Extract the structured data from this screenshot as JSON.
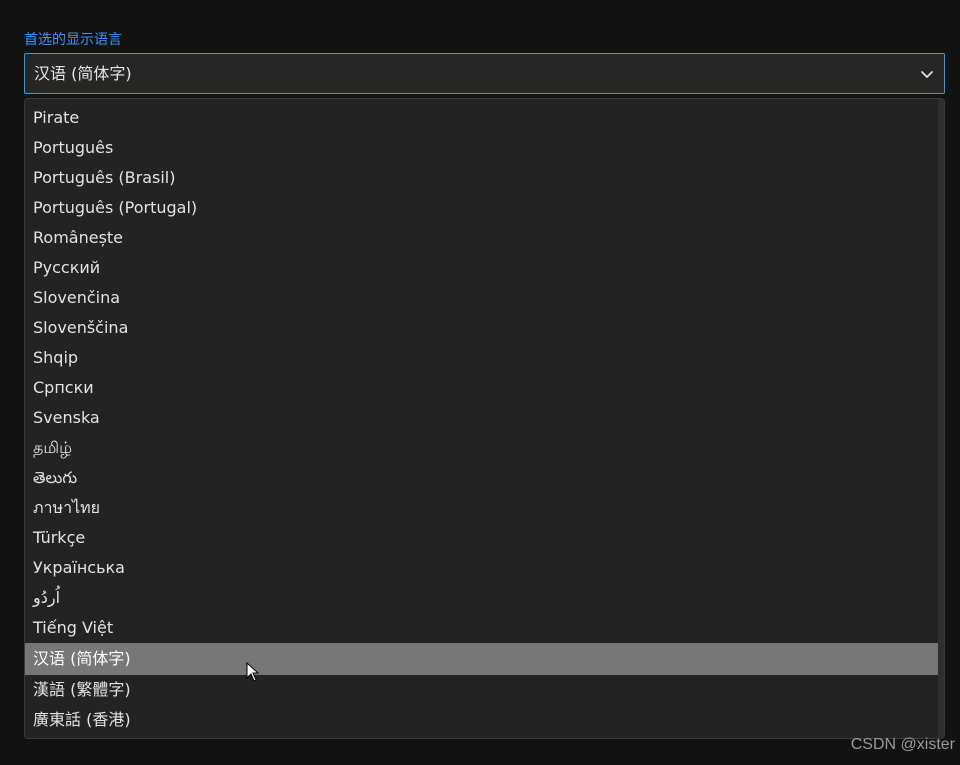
{
  "field": {
    "label": "首选的显示语言",
    "selected_value": "汉语 (简体字)",
    "chevron_icon": "chevron-down-icon"
  },
  "options": [
    {
      "label": "Pirate"
    },
    {
      "label": "Português"
    },
    {
      "label": "Português (Brasil)"
    },
    {
      "label": "Português (Portugal)"
    },
    {
      "label": "Românește"
    },
    {
      "label": "Русский"
    },
    {
      "label": "Slovenčina"
    },
    {
      "label": "Slovenščina"
    },
    {
      "label": "Shqip"
    },
    {
      "label": "Српски"
    },
    {
      "label": "Svenska"
    },
    {
      "label": "தமிழ்"
    },
    {
      "label": "తెలుగు"
    },
    {
      "label": "ภาษาไทย"
    },
    {
      "label": "Türkçe"
    },
    {
      "label": "Українська"
    },
    {
      "label": "اُردُو"
    },
    {
      "label": "Tiếng Việt"
    },
    {
      "label": "汉语 (简体字)",
      "selected": true
    },
    {
      "label": "漢語 (繁體字)"
    },
    {
      "label": "廣東話 (香港)"
    }
  ],
  "watermark": "CSDN @xister",
  "colors": {
    "accent": "#3794ff",
    "selected_bg": "#777777",
    "background": "#121212",
    "dropdown_bg": "#232323"
  }
}
